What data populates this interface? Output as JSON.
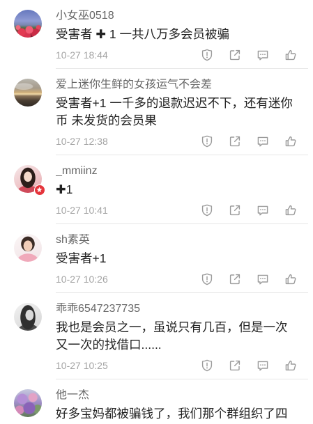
{
  "comments": [
    {
      "avatar": "red-flowers-sky-photo",
      "username": "小女巫0518",
      "text_lines": [
        "受害者 ✚ 1 一共八万多会员被骗"
      ],
      "time": "10-27 18:44"
    },
    {
      "avatar": "cloudy-sunset-photo",
      "username": "爱上迷你生鲜的女孩运气不会差",
      "text_lines": [
        "受害者+1 一千多的退款迟迟不下，还有迷你",
        "币 未发货的会员果"
      ],
      "time": "10-27 12:38"
    },
    {
      "avatar": "girl-portrait-photo",
      "badge": "red-talent-badge-icon",
      "username": "_mmiinz",
      "text_lines": [
        "✚1"
      ],
      "time": "10-27 10:41"
    },
    {
      "avatar": "woman-portrait-photo",
      "username": "sh素英",
      "text_lines": [
        "受害者+1"
      ],
      "time": "10-27 10:26"
    },
    {
      "avatar": "grayscale-portrait-photo",
      "username": "乖乖6547237735",
      "text_lines": [
        "我也是会员之一，虽说只有几百，但是一次",
        "又一次的找借口......"
      ],
      "time": "10-27 10:25"
    },
    {
      "avatar": "purple-flowers-photo",
      "username": "他一杰",
      "text_lines": [
        "好多宝妈都被骗钱了，我们那个群组织了四"
      ]
    }
  ],
  "actions": {
    "icons": [
      "report-icon",
      "share-icon",
      "comment-icon",
      "like-icon"
    ]
  },
  "colors": {
    "username": "#676767",
    "text": "#222222",
    "time": "#a4a4a4",
    "icon": "#9b9b9b",
    "divider": "#e6e6e6",
    "badge": "#e5343b"
  }
}
